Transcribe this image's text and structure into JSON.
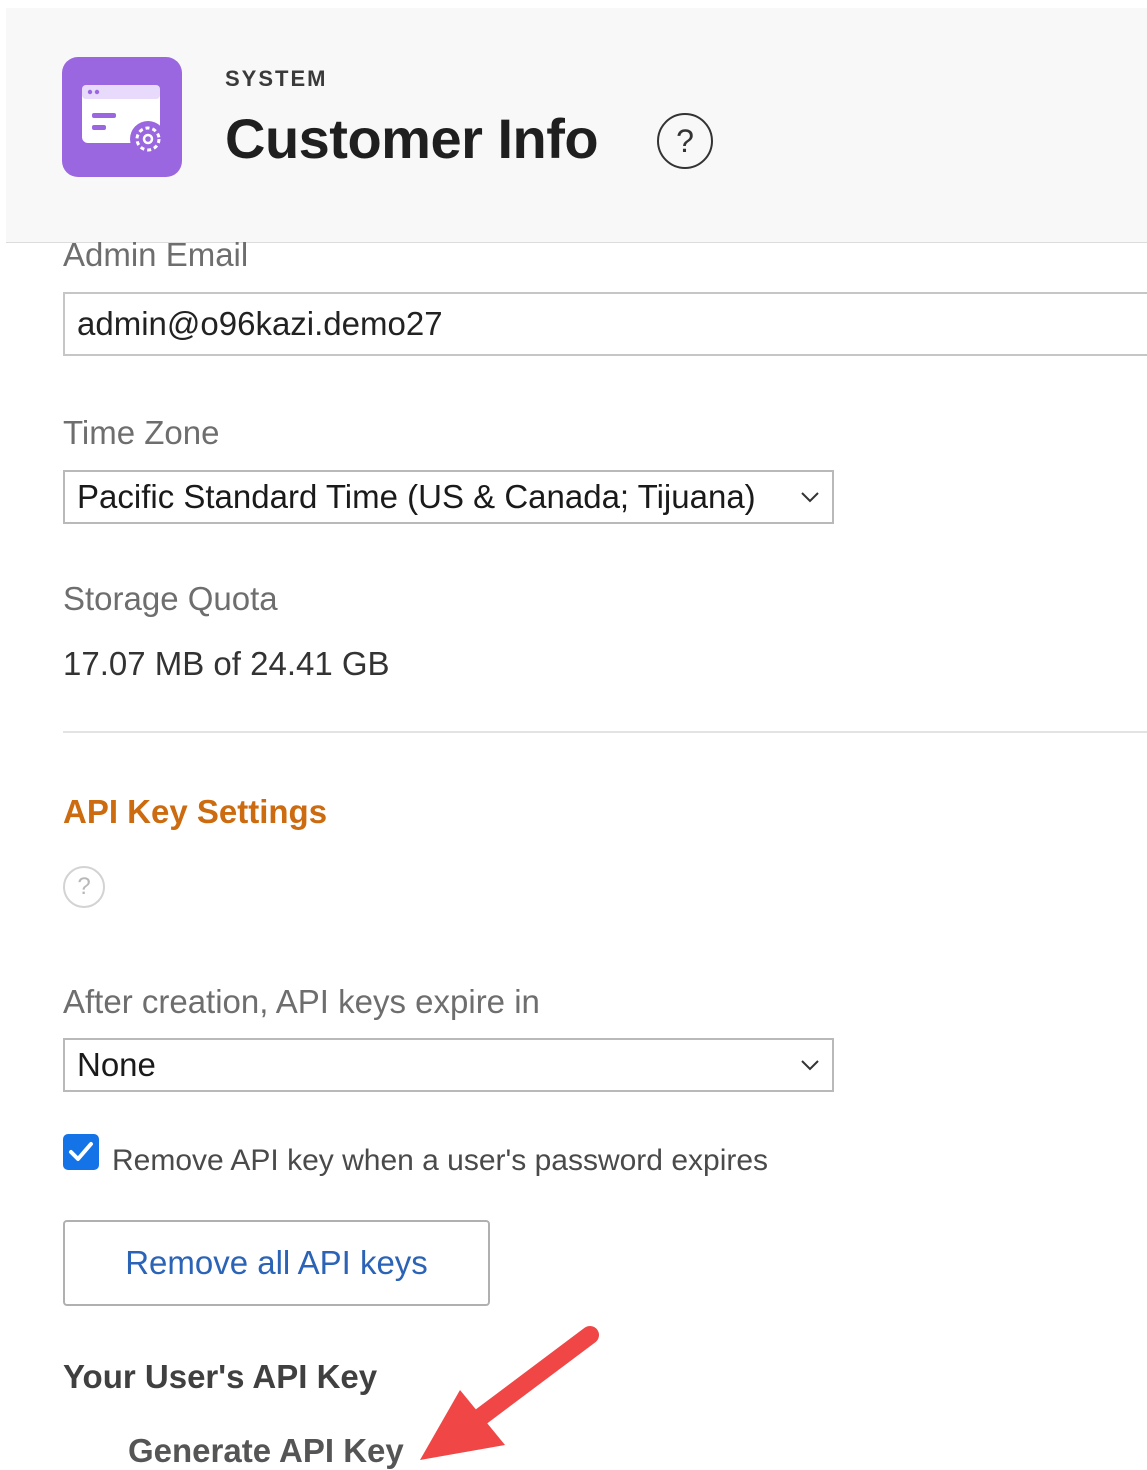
{
  "header": {
    "overline": "SYSTEM",
    "title": "Customer Info",
    "app_icon": "window-settings-icon",
    "help_icon": "question-circle-icon",
    "icon_color": "#9b67e0"
  },
  "form": {
    "admin_email": {
      "label": "Admin Email",
      "value": "admin@o96kazi.demo27"
    },
    "time_zone": {
      "label": "Time Zone",
      "value": "Pacific Standard Time (US & Canada; Tijuana)"
    },
    "storage_quota": {
      "label": "Storage Quota",
      "value": "17.07 MB  of 24.41 GB"
    }
  },
  "api_settings": {
    "title": "API Key Settings",
    "title_color": "#cc6b0f",
    "help_icon": "question-circle-icon",
    "expire_label": "After creation, API keys expire in",
    "expire_value": "None",
    "remove_on_expire": {
      "label": "Remove API key when a user's password expires",
      "checked": true
    },
    "remove_all_button": "Remove all API keys",
    "user_key_title": "Your User's API Key",
    "generate_link": "Generate API Key"
  },
  "annotation": {
    "arrow_color": "#f04646"
  }
}
